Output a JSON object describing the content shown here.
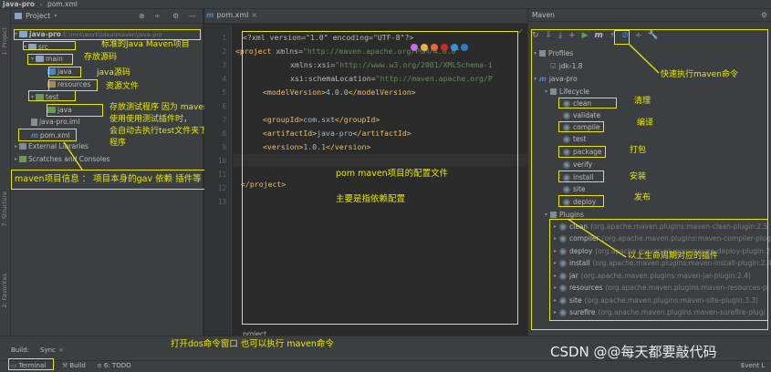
{
  "window": {
    "title": "java-pro",
    "file_tab": "pom.xml"
  },
  "left_tabs": [
    "1: Project",
    "7: Structure",
    "2: Favorites"
  ],
  "project": {
    "header": "Project",
    "root": "java-pro",
    "root_path": "E:\\mnt\\work\\idea\\maven\\java-pro",
    "nodes": [
      "src",
      "main",
      "java",
      "resources",
      "test",
      "java",
      "java-pro.iml",
      "pom.xml",
      "External Libraries",
      "Scratches and Consoles"
    ]
  },
  "editor": {
    "tab": "pom.xml",
    "line_numbers": [
      "1",
      "2",
      "3",
      "4",
      "5",
      "6",
      "7",
      "8",
      "9",
      "10",
      "11",
      "12",
      "13"
    ],
    "lines": {
      "l1_pre": "<?xml version=\"1.0\" encoding=\"UTF-8\"?>",
      "l2_tag": "<project",
      "l2_attr": " xmlns=",
      "l2_str": "\"http://maven.apache.org/POM/4.0.0\"",
      "l3_attr": "xmlns:xsi=",
      "l3_str": "\"http://www.w3.org/2001/XMLSchema-i",
      "l4_attr": "xsi:schemaLocation=",
      "l4_str": "\"http://maven.apache.org/P",
      "l5_open": "<modelVersion>",
      "l5_val": "4.0.0",
      "l5_close": "</modelVersion>",
      "l7_open": "<groupId>",
      "l7_val": "com.sxt",
      "l7_close": "</groupId>",
      "l8_open": "<artifactId>",
      "l8_val": "java-pro",
      "l8_close": "</artifactId>",
      "l9_open": "<version>",
      "l9_val": "1.0.1",
      "l9_close": "</version>",
      "l11_close": "</project>"
    },
    "breadcrumb": "project"
  },
  "maven": {
    "header": "Maven",
    "profiles": "Profiles",
    "profile_item": "jdk-1.8",
    "project": "java-pro",
    "lifecycle": "Lifecycle",
    "lifecycle_items": [
      "clean",
      "validate",
      "compile",
      "test",
      "package",
      "verify",
      "install",
      "site",
      "deploy"
    ],
    "plugins": "Plugins",
    "plugin_items": [
      {
        "name": "clean",
        "desc": "(org.apache.maven.plugins:maven-clean-plugin:2.5"
      },
      {
        "name": "compiler",
        "desc": "(org.apache.maven.plugins:maven-compiler-plug"
      },
      {
        "name": "deploy",
        "desc": "(org.apache.maven.plugins:maven-deploy-plugin:2"
      },
      {
        "name": "install",
        "desc": "(org.apache.maven.plugins:maven-install-plugin:2.4)"
      },
      {
        "name": "jar",
        "desc": "(org.apache.maven.plugins:maven-jar-plugin:2.4)"
      },
      {
        "name": "resources",
        "desc": "(org.apache.maven.plugins:maven-resources-pl"
      },
      {
        "name": "site",
        "desc": "(org.apache.maven.plugins:maven-site-plugin:3.3)"
      },
      {
        "name": "surefire",
        "desc": "(org.apache.maven.plugins:maven-surefire-plugi"
      }
    ]
  },
  "bottom": {
    "build_label": "Build:",
    "sync_label": "Sync",
    "terminal": "Terminal",
    "build": "Build",
    "todo": "6: TODO",
    "event_log": "Event L"
  },
  "annotations": {
    "standard_project": "标准的Java Maven项目",
    "src_code": "存放源码",
    "java_src": "java源码",
    "res_file": "资源文件",
    "test_l1": "存放测试程序     因为 maven",
    "test_l2": "使用使用测试插件时，",
    "test_l3": "会自动去执行test文件夹下的",
    "test_l4": "程序",
    "maven_info": "maven项目信息 ： 项目本身的gav  依赖   插件等",
    "pom_desc": "pom  maven项目的配置文件",
    "pom_desc2": "主要是指依赖配置",
    "quick_exec": "快速执行maven命令",
    "clean": "清理",
    "compile": "编译",
    "package": "打包",
    "install": "安装",
    "deploy": "发布",
    "plugins": "以上生命周期对应的插件",
    "dos": "打开dos命令窗口 也可以执行 maven命令",
    "watermark": "CSDN @@每天都要敲代码"
  },
  "colors": {
    "highlight": "#e8e800",
    "bg": "#2b2b2b",
    "panel": "#3c3f41"
  }
}
